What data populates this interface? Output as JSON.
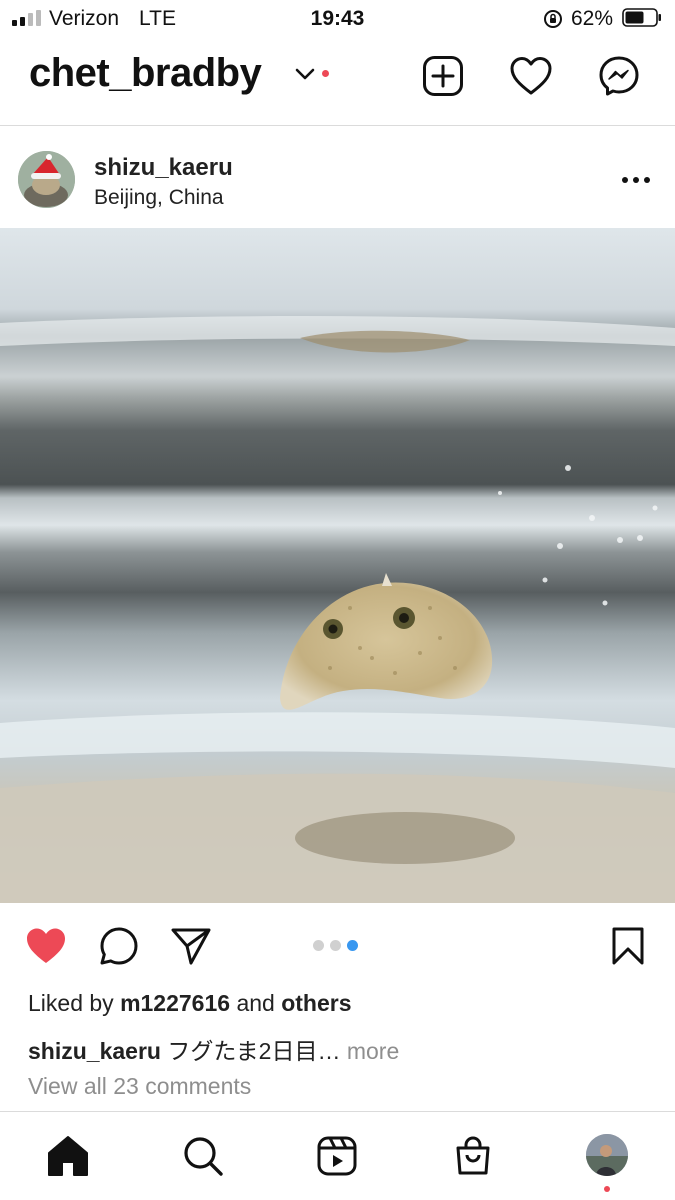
{
  "status_bar": {
    "carrier": "Verizon",
    "network": "LTE",
    "time": "19:43",
    "battery_percent": "62%",
    "battery_level": 0.62
  },
  "header": {
    "username": "chet_bradby",
    "icons": [
      "chevron-down-icon",
      "new-post-icon",
      "heart-icon",
      "messenger-icon"
    ]
  },
  "post": {
    "user": "shizu_kaeru",
    "location": "Beijing, China",
    "carousel": {
      "count": 3,
      "active_index": 2
    },
    "liked": true,
    "likes": {
      "prefix": "Liked by",
      "user": "m1227616",
      "mid": "and",
      "suffix": "others"
    },
    "caption": {
      "user": "shizu_kaeru",
      "text": "フグたま2日目…",
      "more": "more"
    },
    "comments_link": "View all 23 comments"
  },
  "colors": {
    "like_red": "#ed4956",
    "carousel_active": "#3897f0",
    "muted": "#8e8e8e",
    "divider": "#dbdbdb"
  },
  "bottom_nav": [
    "home-icon",
    "search-icon",
    "reels-icon",
    "shop-icon",
    "profile-avatar"
  ]
}
